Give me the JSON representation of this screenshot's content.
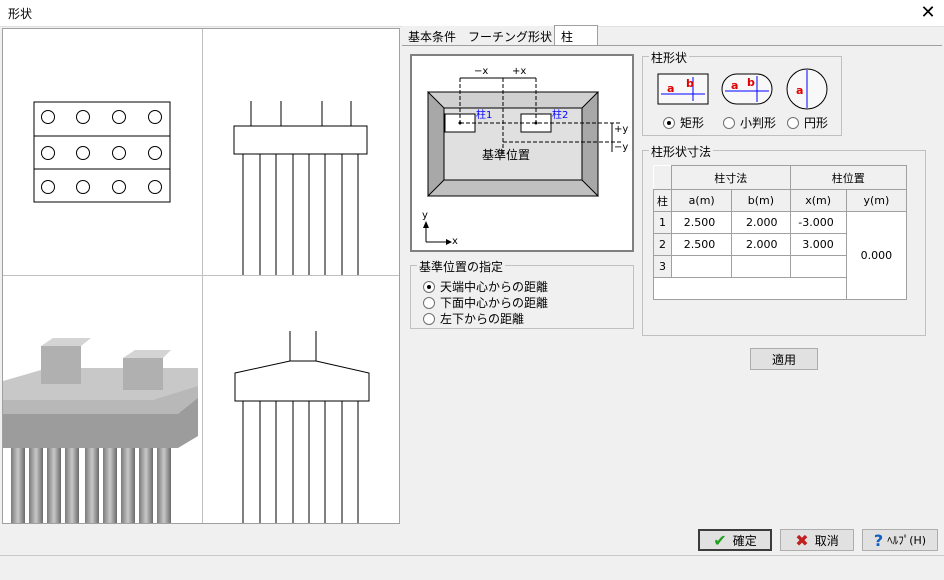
{
  "window": {
    "title": "形状"
  },
  "tabs": [
    {
      "label": "基本条件"
    },
    {
      "label": "フーチング形状"
    },
    {
      "label": "柱"
    }
  ],
  "diagram": {
    "minus_x": "−x",
    "plus_x": "+x",
    "col1": "柱1",
    "col2": "柱2",
    "plus_y": "+y",
    "minus_y": "−y",
    "ref_pos": "基準位置",
    "axis_y": "y",
    "axis_x": "x"
  },
  "reference": {
    "legend": "基準位置の指定",
    "options": [
      "天端中心からの距離",
      "下面中心からの距離",
      "左下からの距離"
    ],
    "selected": 0
  },
  "col_shape": {
    "legend": "柱形状",
    "label_a": "a",
    "label_b": "b",
    "options": [
      "矩形",
      "小判形",
      "円形"
    ],
    "selected": 0
  },
  "col_dims": {
    "legend": "柱形状寸法",
    "group_size": "柱寸法",
    "group_pos": "柱位置",
    "col_header": "柱",
    "headers": [
      "a(m)",
      "b(m)",
      "x(m)",
      "y(m)"
    ],
    "rows": [
      {
        "n": "1",
        "a": "2.500",
        "b": "2.000",
        "x": "-3.000"
      },
      {
        "n": "2",
        "a": "2.500",
        "b": "2.000",
        "x": "3.000"
      },
      {
        "n": "3",
        "a": "",
        "b": "",
        "x": ""
      }
    ],
    "y": "0.000"
  },
  "buttons": {
    "apply": "適用",
    "ok": "確定",
    "cancel": "取消",
    "help": "ﾍﾙﾌﾟ(H)"
  },
  "colors": {
    "dim_red": "#e00000",
    "dim_blue": "#0000ff",
    "ok_green": "#20a020",
    "cancel_red": "#c02020",
    "help_blue": "#1060c0"
  }
}
